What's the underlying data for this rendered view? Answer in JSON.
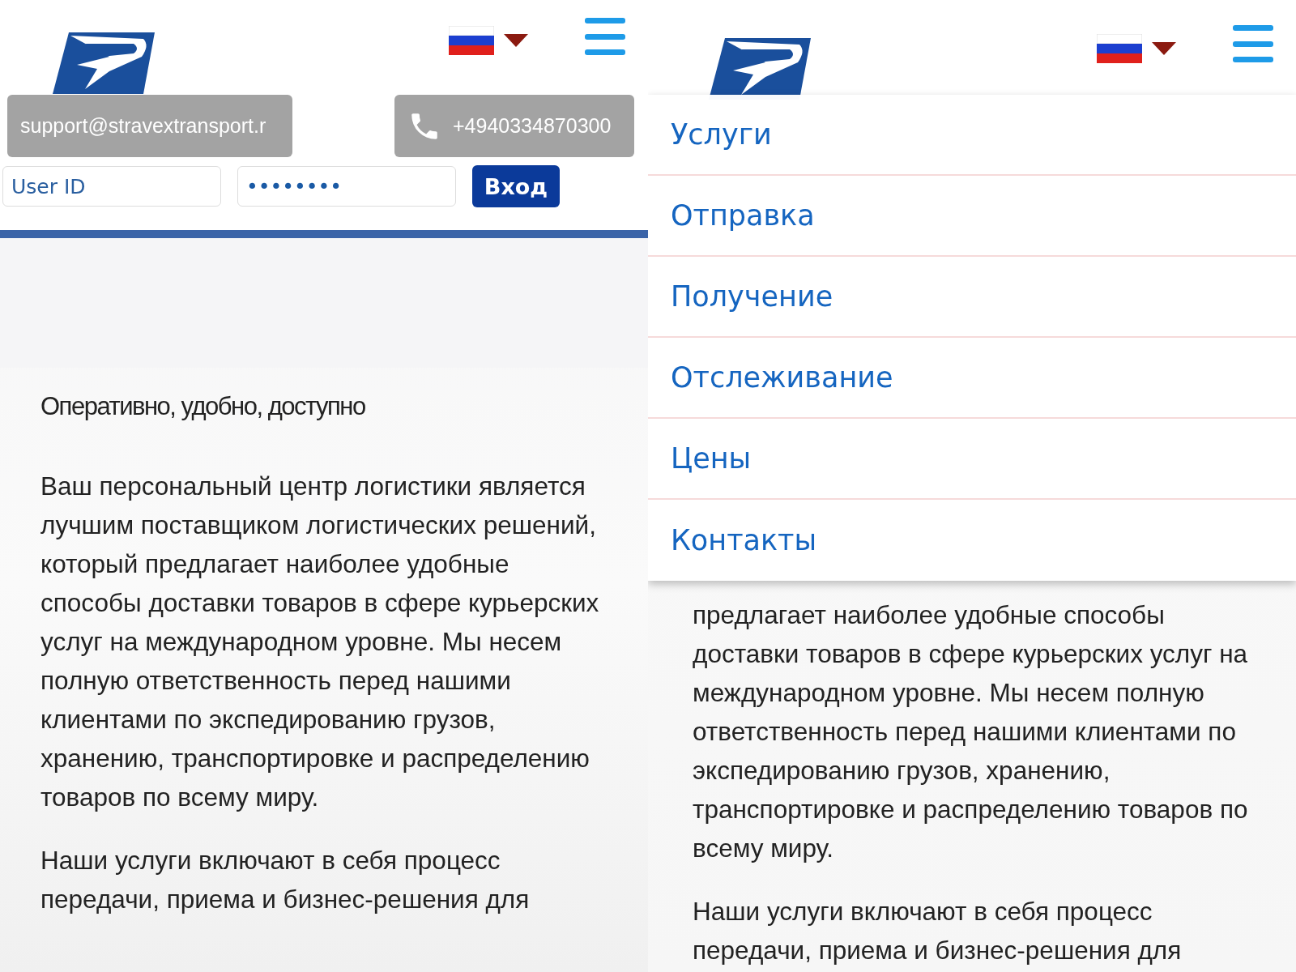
{
  "left_screen": {
    "header": {
      "email": "support@stravextransport.r",
      "phone": "+4940334870300",
      "login": {
        "user_id_placeholder": "User ID",
        "password_value": "••••••••",
        "submit": "Вход"
      }
    },
    "tagline": "Оперативно, удобно, доступно",
    "paragraphs": [
      "Ваш персональный центр логистики является лучшим поставщиком логистических решений, который предлагает наиболее удобные способы доставки товаров в сфере курьерских услуг на международном уровне. Мы несем полную ответственность перед нашими клиентами по экспедированию грузов, хранению, транспортировке и распределению товаров по всему миру.",
      "Наши услуги включают в себя процесс передачи, приема и бизнес-решения для"
    ]
  },
  "right_screen": {
    "menu_items": [
      {
        "label": "Услуги"
      },
      {
        "label": "Отправка"
      },
      {
        "label": "Получение"
      },
      {
        "label": "Отслеживание"
      },
      {
        "label": "Цены"
      },
      {
        "label": "Контакты"
      }
    ],
    "paragraphs": [
      "предлагает наиболее удобные способы доставки товаров в сфере курьерских услуг на международном уровне. Мы несем полную ответственность перед нашими клиентами по экспедированию грузов, хранению, транспортировке и распределению товаров по всему миру.",
      "Наши услуги включают в себя процесс передачи, приема и бизнес-решения для"
    ]
  }
}
